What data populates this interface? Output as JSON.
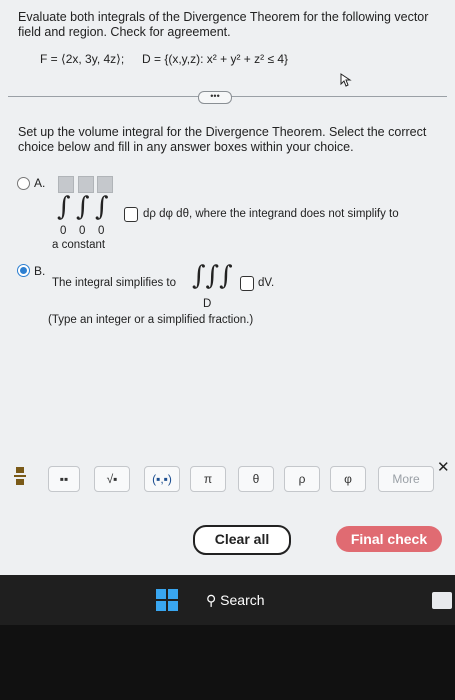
{
  "question": {
    "line1": "Evaluate both integrals of the Divergence Theorem for the following vector",
    "line2": "field and region. Check for agreement.",
    "field": "F = ⟨2x, 3y, 4z⟩;",
    "region": "D = {(x,y,z): x² + y² + z² ≤ 4}",
    "more_pill": "•••"
  },
  "instructions": {
    "line1": "Set up the volume integral for the Divergence Theorem. Select the correct",
    "line2": "choice below and fill in any answer boxes within your choice."
  },
  "option_a": {
    "letter": "A.",
    "lower_limits": [
      "0",
      "0",
      "0"
    ],
    "differentials": "dρ dφ dθ, where the integrand does not simplify to",
    "continuation": "a constant"
  },
  "option_b": {
    "letter": "B.",
    "lead": "The integral simplifies to",
    "region_sub": "D",
    "dv": "dV.",
    "hint": "(Type an integer or a simplified fraction.)"
  },
  "toolbar": {
    "buttons": [
      "▪▪",
      "√▪",
      "(▪,▪)",
      "π",
      "θ",
      "ρ",
      "φ",
      "More"
    ]
  },
  "actions": {
    "clear_all": "Clear all",
    "final_check": "Final check"
  },
  "taskbar": {
    "search": "Search"
  },
  "colors": {
    "accent": "#2d7fd1",
    "final_check_bg": "#e06b72",
    "screen_bg": "#eef0f2"
  }
}
